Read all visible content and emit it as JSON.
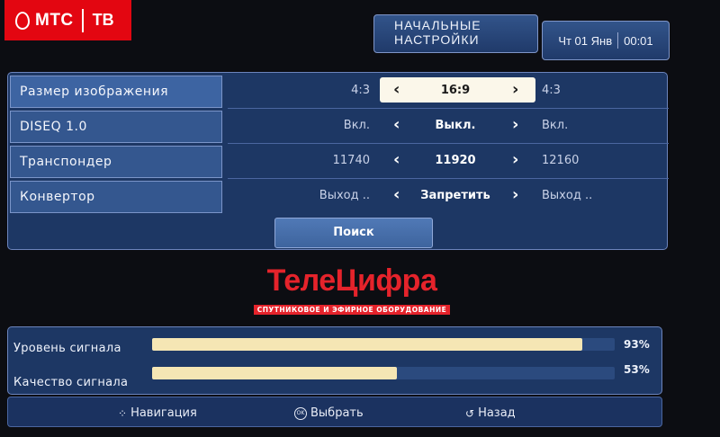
{
  "brand": {
    "name": "МТС",
    "product": "ТВ",
    "color": "#e30611"
  },
  "header": {
    "settings_line1": "НАЧАЛЬНЫЕ",
    "settings_line2": "НАСТРОЙКИ",
    "date": "Чт 01 Янв",
    "time": "00:01"
  },
  "settings": [
    {
      "label": "Размер изображения",
      "prev": "4:3",
      "value": "16:9",
      "next": "4:3"
    },
    {
      "label": "DISEQ 1.0",
      "prev": "Вкл.",
      "value": "Выкл.",
      "next": "Вкл."
    },
    {
      "label": "Транспондер",
      "prev": "11740",
      "value": "11920",
      "next": "12160"
    },
    {
      "label": "Конвертор",
      "prev": "Выход ..",
      "value": "Запретить",
      "next": "Выход .."
    }
  ],
  "search_label": "Поиск",
  "watermark": {
    "title": "ТелеЦифра",
    "subtitle": "СПУТНИКОВОЕ И ЭФИРНОЕ ОБОРУДОВАНИЕ"
  },
  "signal": {
    "level_label": "Уровень сигнала",
    "level_value": 93,
    "level_text": "93%",
    "quality_label": "Качество сигнала",
    "quality_value": 53,
    "quality_text": "53%"
  },
  "nav": {
    "navigate": "Навигация",
    "select": "Выбрать",
    "back": "Назад",
    "select_icon": "OK",
    "navigate_icon": "dpad-icon",
    "back_icon": "back-arrow-icon"
  }
}
